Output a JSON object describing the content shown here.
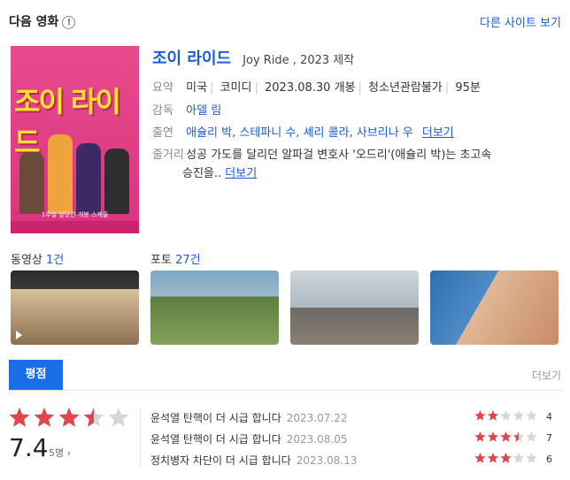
{
  "header": {
    "title": "다음 영화",
    "info_icon": "!",
    "other_sites": "다른 사이트 보기"
  },
  "movie": {
    "title": "조이 라이드",
    "original": "Joy Ride , 2023 제작",
    "poster_title": "조이 라이드",
    "poster_caption": "1주일 앞당긴 개봉 스케줄",
    "summary_label": "요약",
    "summary": [
      "미국",
      "코미디",
      "2023.08.30 개봉",
      "청소년관람불가",
      "95분"
    ],
    "director_label": "감독",
    "director": "아델 림",
    "cast_label": "출연",
    "cast": "애슐리 박, 스테파니 수, 셰리 콜라, 사브리나 우",
    "more": "더보기",
    "synopsis_label": "줄거리",
    "synopsis_line1": "성공 가도를 달리던 알파걸 변호사 '오드리'(애슐리 박)는 초고속",
    "synopsis_line2": "승진을.."
  },
  "media": {
    "video_label": "동영상",
    "video_count": "1건",
    "photo_label": "포토",
    "photo_count": "27건"
  },
  "ratings": {
    "tab": "평점",
    "more": "더보기",
    "score": "7.4",
    "votes": "5명 ›",
    "score_fraction": 0.74,
    "reviews": [
      {
        "text": "윤석열 탄핵이 더 시급 합니다",
        "date": "2023.07.22",
        "score": "4",
        "stars": 2
      },
      {
        "text": "윤석열 탄핵이 더 시급 합니다",
        "date": "2023.08.05",
        "score": "7",
        "stars": 3.5
      },
      {
        "text": "정치병자 차단이 더 시급 합니다",
        "date": "2023.08.13",
        "score": "6",
        "stars": 3
      }
    ]
  },
  "colors": {
    "accent": "#1a5bd6",
    "tab_active": "#1a6fe8",
    "star": "#e0464d",
    "poster_pink": "#e84a8f"
  }
}
